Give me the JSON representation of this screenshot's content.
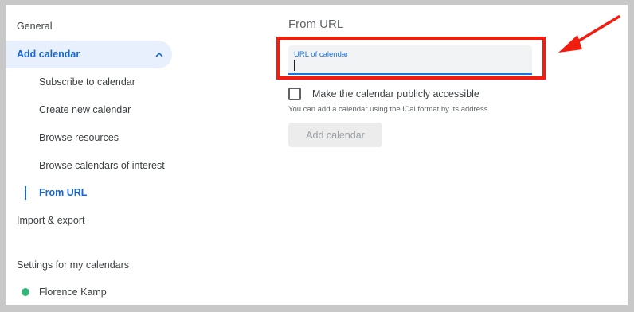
{
  "sidebar": {
    "general": "General",
    "add_calendar": "Add calendar",
    "sub_items": [
      "Subscribe to calendar",
      "Create new calendar",
      "Browse resources",
      "Browse calendars of interest",
      "From URL"
    ],
    "import_export": "Import & export",
    "my_calendars_title": "Settings for my calendars",
    "my_calendars": [
      {
        "name": "Florence Kamp",
        "color": "#33b679"
      }
    ],
    "chevron_icon": "chevron-up-icon"
  },
  "main": {
    "title": "From URL",
    "url_field": {
      "label": "URL of calendar",
      "value": ""
    },
    "public_checkbox": {
      "label": "Make the calendar publicly accessible",
      "checked": false
    },
    "helper_text": "You can add a calendar using the iCal format by its address.",
    "add_button": "Add calendar"
  },
  "annotation": {
    "color": "#f21d0f",
    "arrow_icon": "arrow-pointer-icon"
  },
  "colors": {
    "accent": "#1967d2",
    "active_bg": "#e8f0fe"
  }
}
